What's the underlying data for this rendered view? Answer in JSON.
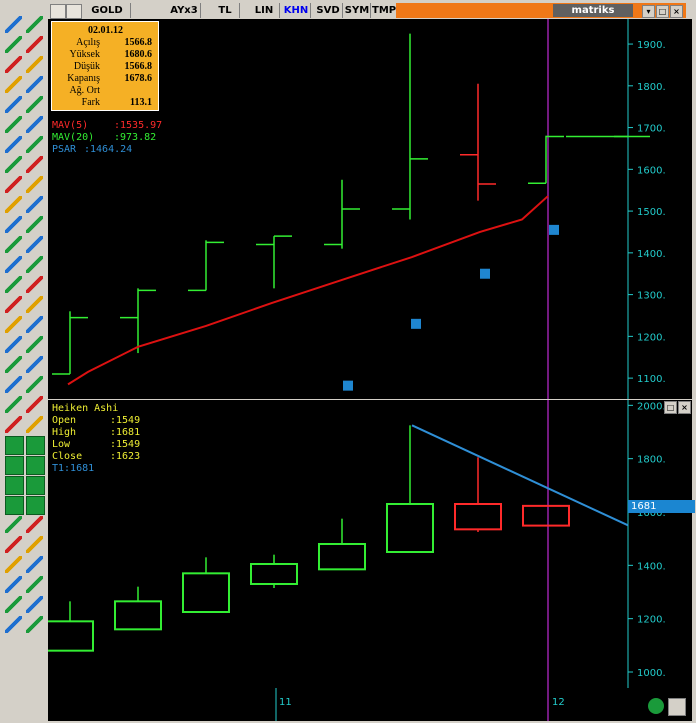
{
  "topbar": {
    "tabs": [
      {
        "label": "GOLD",
        "active": false
      },
      {
        "label": "AYx3",
        "active": false
      },
      {
        "label": "TL",
        "active": false
      },
      {
        "label": "LIN",
        "active": false
      },
      {
        "label": "KHN",
        "active": true
      },
      {
        "label": "SVD",
        "active": false
      },
      {
        "label": "SYM",
        "active": false
      },
      {
        "label": "TMP",
        "active": false
      }
    ],
    "brand": "matriks",
    "window_buttons": {
      "minimize": "▾",
      "restore": "□",
      "close": "×"
    },
    "accent_color": "#f07818"
  },
  "infobox": {
    "date": "02.01.12",
    "rows": [
      {
        "label": "Açılış",
        "value": "1566.8"
      },
      {
        "label": "Yüksek",
        "value": "1680.6"
      },
      {
        "label": "Düşük",
        "value": "1566.8"
      },
      {
        "label": "Kapanış",
        "value": "1678.6"
      },
      {
        "label": "Ağ. Ort",
        "value": ""
      },
      {
        "label": "Fark",
        "value": "113.1"
      }
    ]
  },
  "upper_indicators": [
    {
      "name": "MAV(5)",
      "value": ":1535.97",
      "color": "#ff2a2a"
    },
    {
      "name": "MAV(20)",
      "value": ":973.82",
      "color": "#33ee33"
    },
    {
      "name": "PSAR",
      "value": ":1464.24",
      "color": "#2f8fd6"
    }
  ],
  "lower_panel": {
    "title": "Heiken Ashi",
    "rows": [
      {
        "label": "Open",
        "value": ":1549"
      },
      {
        "label": "High",
        "value": ":1681"
      },
      {
        "label": "Low",
        "value": ":1549"
      },
      {
        "label": "Close",
        "value": ":1623"
      }
    ],
    "trendline_label": "T1:1681",
    "price_tag": "1681",
    "buttons": {
      "restore": "□",
      "close": "×"
    }
  },
  "x_axis": {
    "ticks": [
      "11",
      "12"
    ]
  },
  "chart_data": [
    {
      "type": "ohlc",
      "y_ticks": [
        "1900.",
        "1800.",
        "1700.",
        "1600.",
        "1500.",
        "1400.",
        "1300.",
        "1200.",
        "1100."
      ],
      "ylim": [
        1050,
        1960
      ],
      "bars": [
        {
          "open": 1110,
          "high": 1260,
          "low": 1110,
          "close": 1245,
          "color": "#33ee33"
        },
        {
          "open": 1245,
          "high": 1315,
          "low": 1160,
          "close": 1310,
          "color": "#33ee33"
        },
        {
          "open": 1310,
          "high": 1430,
          "low": 1310,
          "close": 1425,
          "color": "#33ee33"
        },
        {
          "open": 1420,
          "high": 1440,
          "low": 1315,
          "close": 1440,
          "color": "#33ee33"
        },
        {
          "open": 1420,
          "high": 1575,
          "low": 1410,
          "close": 1505,
          "color": "#33ee33"
        },
        {
          "open": 1505,
          "high": 1925,
          "low": 1480,
          "close": 1625,
          "color": "#33ee33"
        },
        {
          "open": 1635,
          "high": 1805,
          "low": 1525,
          "close": 1565,
          "color": "#ff2a2a"
        },
        {
          "open": 1566.8,
          "high": 1680.6,
          "low": 1566.8,
          "close": 1678.6,
          "color": "#33ee33"
        },
        {
          "open": 1678.6,
          "high": 1678.6,
          "low": 1678.6,
          "close": 1678.6,
          "color": "#33ee33"
        }
      ],
      "mav5": [
        1085,
        1115,
        1175,
        1225,
        1280,
        1340,
        1390,
        1450,
        1480,
        1535.97
      ],
      "psar": [
        1082,
        1230,
        1350,
        1455
      ],
      "colors": {
        "mav": "#dd1111",
        "psar": "#1f86d0",
        "axis": "#22cccc",
        "cursor": "#9922aa"
      }
    },
    {
      "type": "heikin_ashi",
      "y_ticks": [
        "2000.",
        "1800.",
        "1600.",
        "1400.",
        "1200.",
        "1000."
      ],
      "ylim": [
        940,
        2020
      ],
      "candles": [
        {
          "open": 1080,
          "close": 1190,
          "high": 1265,
          "low": 1080,
          "color": "#33ee33"
        },
        {
          "open": 1160,
          "close": 1265,
          "high": 1320,
          "low": 1160,
          "color": "#33ee33"
        },
        {
          "open": 1225,
          "close": 1370,
          "high": 1430,
          "low": 1225,
          "color": "#33ee33"
        },
        {
          "open": 1330,
          "close": 1405,
          "high": 1440,
          "low": 1315,
          "color": "#33ee33"
        },
        {
          "open": 1385,
          "close": 1480,
          "high": 1575,
          "low": 1385,
          "color": "#33ee33"
        },
        {
          "open": 1450,
          "close": 1630,
          "high": 1925,
          "low": 1450,
          "color": "#33ee33"
        },
        {
          "open": 1630,
          "close": 1535,
          "high": 1805,
          "low": 1525,
          "color": "#ff2a2a"
        },
        {
          "open": 1623,
          "close": 1549,
          "high": 1623,
          "low": 1549,
          "color": "#ff2a2a"
        }
      ],
      "trendline": [
        1925,
        1550
      ],
      "colors": {
        "trend": "#2f8fd6",
        "axis": "#22cccc",
        "cursor": "#9922aa",
        "price_tag": "#1b86d1"
      }
    }
  ]
}
